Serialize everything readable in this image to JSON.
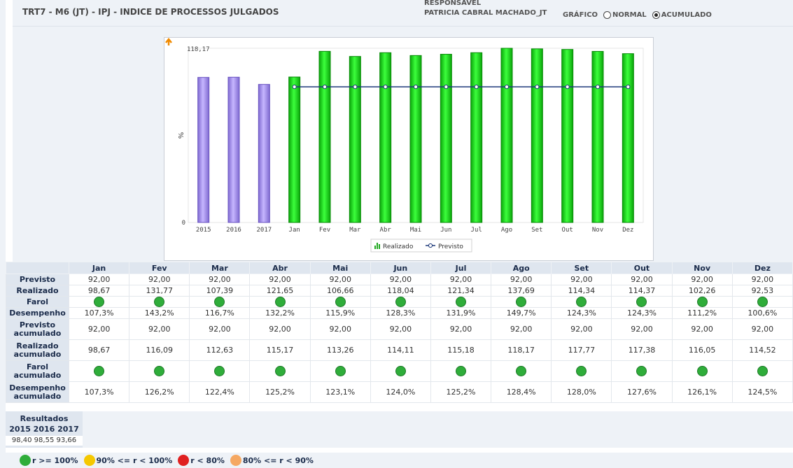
{
  "header": {
    "title": "TRT7 - M6 (JT) - IPJ - INDICE DE PROCESSOS JULGADOS",
    "responsavel_label": "RESPONSAVEL",
    "responsavel_name": "PATRICIA CABRAL MACHADO_JT",
    "grafico_label": "GRÁFICO",
    "option_normal": "NORMAL",
    "option_acumulado": "ACUMULADO",
    "selected": "ACUMULADO"
  },
  "chart_data": {
    "type": "bar",
    "categories": [
      "2015",
      "2016",
      "2017",
      "Jan",
      "Fev",
      "Mar",
      "Abr",
      "Mai",
      "Jun",
      "Jul",
      "Ago",
      "Set",
      "Out",
      "Nov",
      "Dez"
    ],
    "ylabel": "%",
    "ylim": [
      0,
      118.17
    ],
    "ytick_labels": [
      "0",
      "118,17"
    ],
    "series": [
      {
        "name": "Realizado",
        "type": "bar",
        "values": [
          98.4,
          98.55,
          93.66,
          98.67,
          116.09,
          112.63,
          115.17,
          113.26,
          114.11,
          115.18,
          118.17,
          117.77,
          117.38,
          116.05,
          114.52
        ],
        "colors": [
          "#a48ae8",
          "#a48ae8",
          "#a48ae8",
          "#22dd22",
          "#22dd22",
          "#22dd22",
          "#22dd22",
          "#22dd22",
          "#22dd22",
          "#22dd22",
          "#22dd22",
          "#22dd22",
          "#22dd22",
          "#22dd22",
          "#22dd22"
        ]
      },
      {
        "name": "Previsto",
        "type": "line",
        "values": [
          null,
          null,
          null,
          92,
          92,
          92,
          92,
          92,
          92,
          92,
          92,
          92,
          92,
          92,
          92
        ],
        "color": "#1f3a7a"
      }
    ],
    "legend": [
      "Realizado",
      "Previsto"
    ],
    "legend_position": "bottom"
  },
  "table": {
    "months": [
      "Jan",
      "Fev",
      "Mar",
      "Abr",
      "Mai",
      "Jun",
      "Jul",
      "Ago",
      "Set",
      "Out",
      "Nov",
      "Dez"
    ],
    "rows": [
      {
        "label": "Previsto",
        "tall": false,
        "values": [
          "92,00",
          "92,00",
          "92,00",
          "92,00",
          "92,00",
          "92,00",
          "92,00",
          "92,00",
          "92,00",
          "92,00",
          "92,00",
          "92,00"
        ]
      },
      {
        "label": "Realizado",
        "tall": false,
        "values": [
          "98,67",
          "131,77",
          "107,39",
          "121,65",
          "106,66",
          "118,04",
          "121,34",
          "137,69",
          "114,34",
          "114,37",
          "102,26",
          "92,53"
        ]
      },
      {
        "label": "Farol",
        "tall": false,
        "farol": true,
        "values": [
          "green",
          "green",
          "green",
          "green",
          "green",
          "green",
          "green",
          "green",
          "green",
          "green",
          "green",
          "green"
        ]
      },
      {
        "label": "Desempenho",
        "tall": false,
        "values": [
          "107,3%",
          "143,2%",
          "116,7%",
          "132,2%",
          "115,9%",
          "128,3%",
          "131,9%",
          "149,7%",
          "124,3%",
          "124,3%",
          "111,2%",
          "100,6%"
        ]
      },
      {
        "label": "Previsto acumulado",
        "tall": true,
        "values": [
          "92,00",
          "92,00",
          "92,00",
          "92,00",
          "92,00",
          "92,00",
          "92,00",
          "92,00",
          "92,00",
          "92,00",
          "92,00",
          "92,00"
        ]
      },
      {
        "label": "Realizado acumulado",
        "tall": true,
        "values": [
          "98,67",
          "116,09",
          "112,63",
          "115,17",
          "113,26",
          "114,11",
          "115,18",
          "118,17",
          "117,77",
          "117,38",
          "116,05",
          "114,52"
        ]
      },
      {
        "label": "Farol acumulado",
        "tall": true,
        "farol": true,
        "values": [
          "green",
          "green",
          "green",
          "green",
          "green",
          "green",
          "green",
          "green",
          "green",
          "green",
          "green",
          "green"
        ]
      },
      {
        "label": "Desempenho acumulado",
        "tall": true,
        "values": [
          "107,3%",
          "126,2%",
          "122,4%",
          "125,2%",
          "123,1%",
          "124,0%",
          "125,2%",
          "128,4%",
          "128,0%",
          "127,6%",
          "126,1%",
          "124,5%"
        ]
      }
    ]
  },
  "results": {
    "title": "Resultados",
    "years": "2015 2016 2017",
    "values": "98,40 98,55 93,66"
  },
  "legend": [
    {
      "text": "r >= 100%",
      "color": "#2fad3a"
    },
    {
      "text": "90% <= r < 100%",
      "color": "#f5c800"
    },
    {
      "text": "r < 80%",
      "color": "#e02020"
    },
    {
      "text": "80% <= r < 90%",
      "color": "#f5a862"
    }
  ]
}
